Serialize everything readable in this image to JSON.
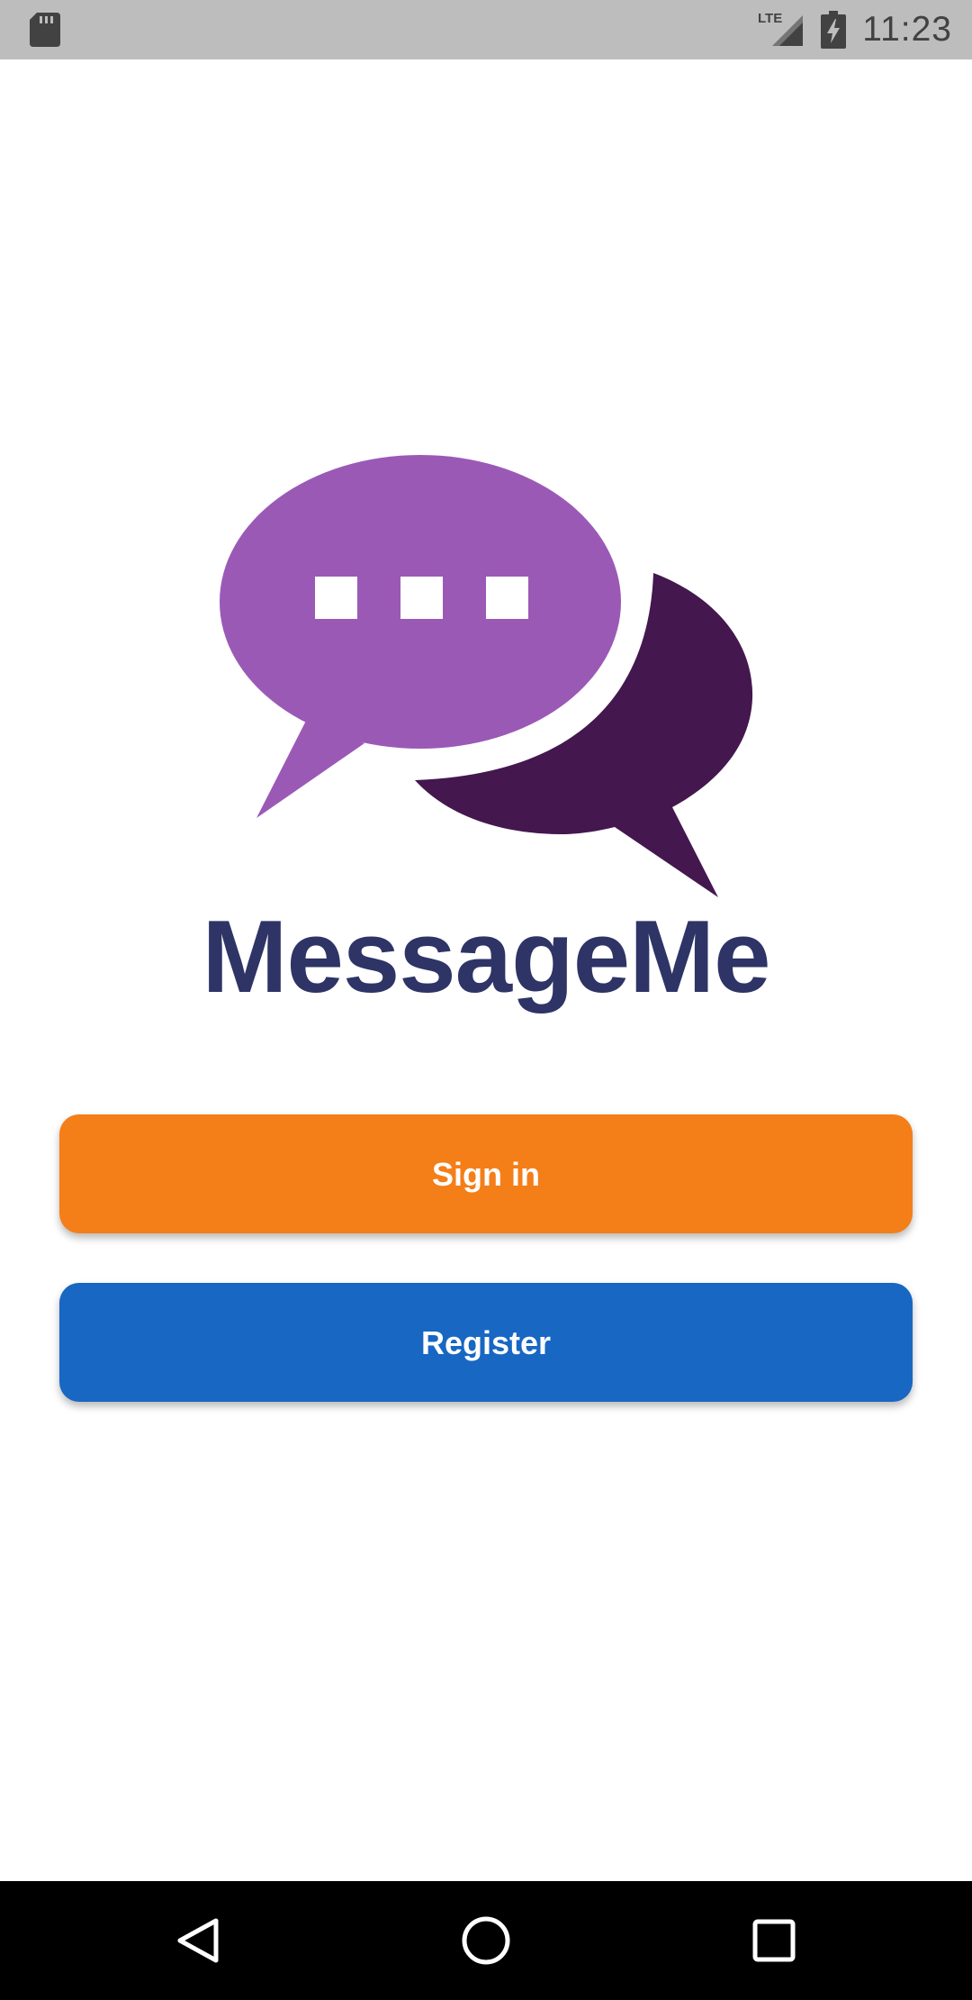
{
  "status_bar": {
    "time": "11:23",
    "network": "LTE",
    "icons": [
      "sd-card-icon",
      "lte-signal-icon",
      "battery-charging-icon"
    ]
  },
  "app": {
    "name": "MessageMe",
    "logo_icon": "chat-bubbles-icon"
  },
  "buttons": {
    "sign_in": "Sign in",
    "register": "Register"
  },
  "nav_bar": {
    "icons": [
      "back-icon",
      "home-icon",
      "recents-icon"
    ]
  },
  "colors": {
    "status_bar_bg": "#bdbdbd",
    "title": "#2e3466",
    "sign_in_button": "#f47e18",
    "register_button": "#1767c3",
    "bubble_front": "#9b59b6",
    "bubble_back": "#44174f",
    "nav_bar_bg": "#000000"
  }
}
